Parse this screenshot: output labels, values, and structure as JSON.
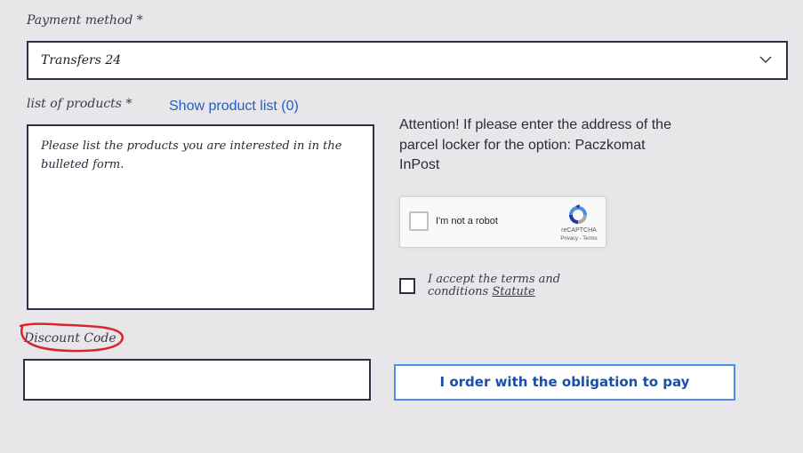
{
  "payment": {
    "label": "Payment method *",
    "value": "Transfers 24"
  },
  "products": {
    "label": "list of products *",
    "show_link": "Show product list (0)",
    "placeholder": "Please list the products you are interested in in the bulleted form."
  },
  "attention": "Attention! If please enter the address of the parcel locker for the option: Paczkomat InPost",
  "recaptcha": {
    "label": "I'm not a robot",
    "brand": "reCAPTCHA",
    "links": "Privacy - Terms"
  },
  "terms": {
    "text": "I accept the terms and conditions",
    "link": "Statute"
  },
  "discount": {
    "label": "Discount Code",
    "value": ""
  },
  "order_button": "I order with the obligation to pay",
  "colors": {
    "background": "#e8e6e8",
    "border": "#2e2f45",
    "link": "#1f5fc9",
    "button_border": "#4a8ee8",
    "annotation": "#d9262c"
  }
}
